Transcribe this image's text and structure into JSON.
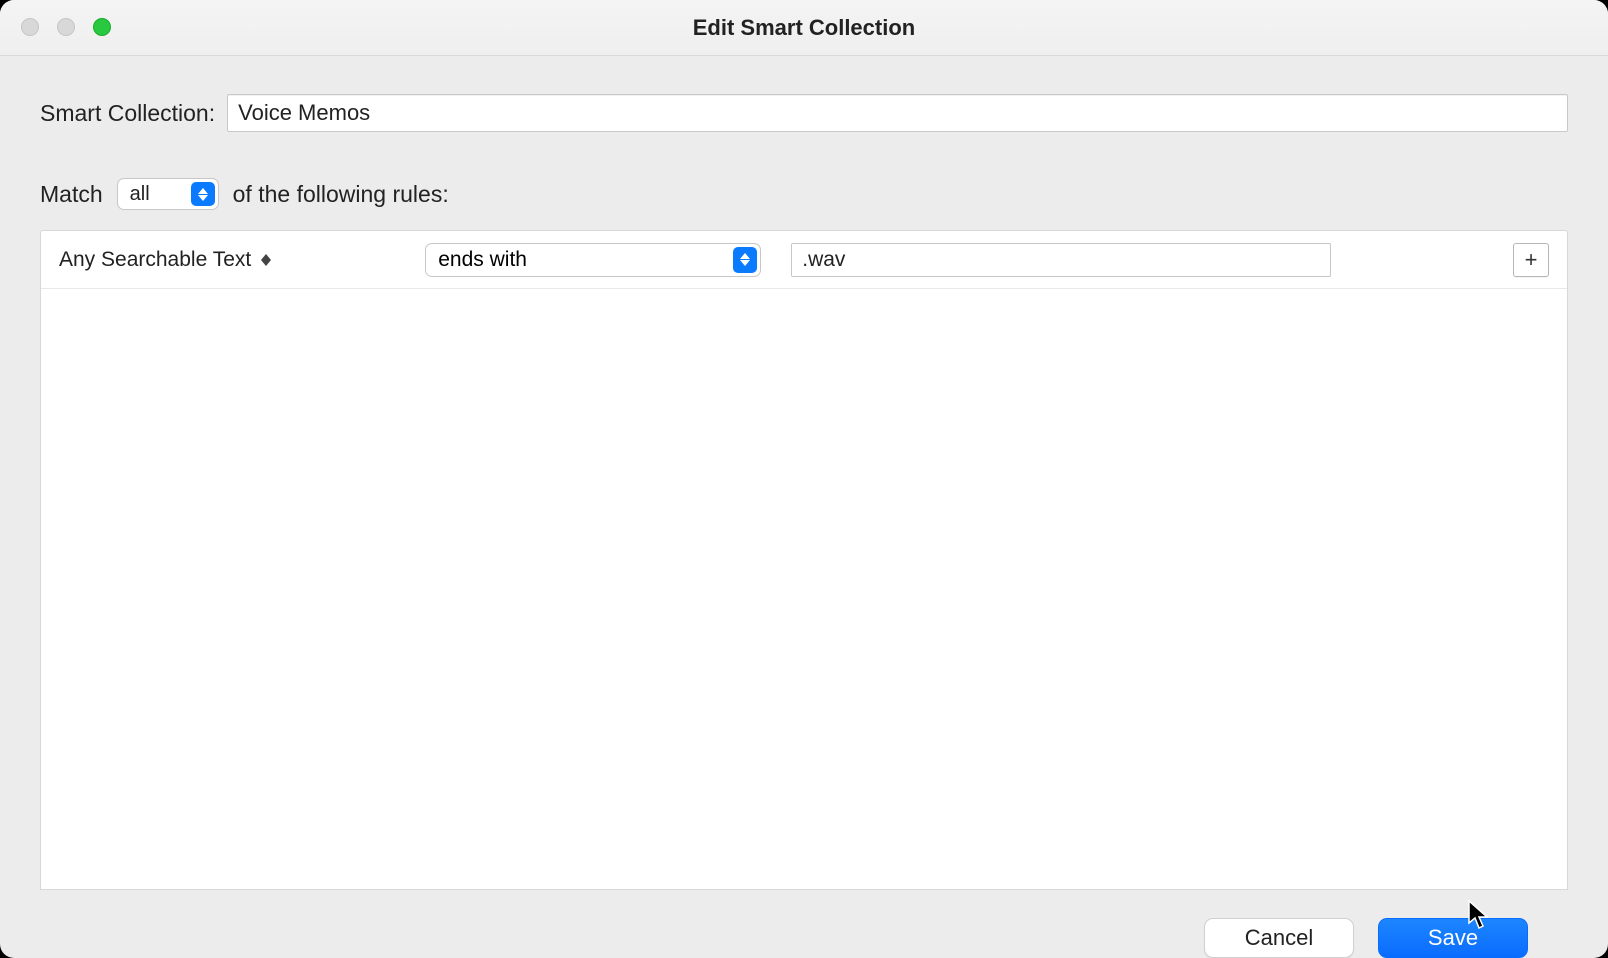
{
  "window": {
    "title": "Edit Smart Collection"
  },
  "collection": {
    "label": "Smart Collection:",
    "name": "Voice Memos"
  },
  "match": {
    "prefix": "Match",
    "mode": "all",
    "suffix": "of the following rules:"
  },
  "rules": [
    {
      "field": "Any Searchable Text",
      "comparator": "ends with",
      "value": ".wav"
    }
  ],
  "buttons": {
    "add": "+",
    "cancel": "Cancel",
    "save": "Save"
  }
}
